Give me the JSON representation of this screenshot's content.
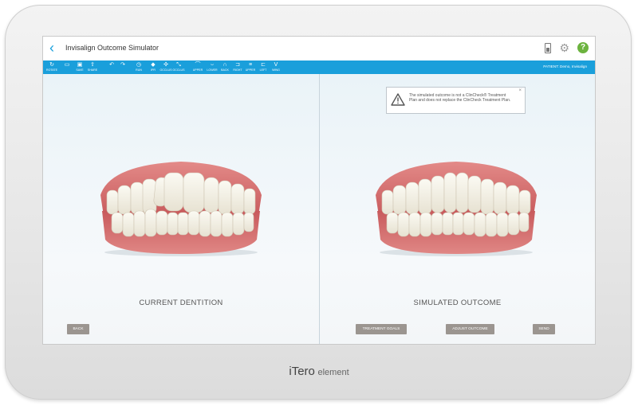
{
  "app": {
    "title": "Invisalign Outcome Simulator",
    "patient": "PATIENT: Demo, Invisalign"
  },
  "toolbar": {
    "tools": [
      {
        "icon": "↻",
        "label": "ROTATE"
      },
      {
        "icon": "▭",
        "label": ""
      },
      {
        "icon": "▣",
        "label": "SAVE"
      },
      {
        "icon": "⇪",
        "label": "SHARE"
      },
      {
        "icon": "↶",
        "label": ""
      },
      {
        "icon": "↷",
        "label": ""
      },
      {
        "icon": "◷",
        "label": "RUN"
      },
      {
        "icon": "◆",
        "label": "IPR"
      },
      {
        "icon": "✣",
        "label": "OCCLUS"
      },
      {
        "icon": "⤡",
        "label": "OCCLUS"
      },
      {
        "icon": "⌒",
        "label": "UPPER"
      },
      {
        "icon": "⌣",
        "label": "LOWER"
      },
      {
        "icon": "∩",
        "label": "BACK"
      },
      {
        "icon": "⊐",
        "label": "RIGHT"
      },
      {
        "icon": "≡",
        "label": "UPPER"
      },
      {
        "icon": "⊏",
        "label": "LEFT"
      },
      {
        "icon": "V",
        "label": "WING"
      }
    ]
  },
  "left_panel": {
    "label": "CURRENT DENTITION",
    "back_button": "BACK"
  },
  "right_panel": {
    "label": "SIMULATED OUTCOME",
    "notice": "The simulated outcome is not a ClinCheck® Treatment Plan and does not replace the ClinCheck Treatment Plan.",
    "notice_close": "×",
    "buttons": {
      "treatment_goals": "TREATMENT GOALS",
      "adjust_outcome": "ADJUST OUTCOME",
      "send": "SEND"
    }
  },
  "device": {
    "brand_main": "iTero",
    "brand_sub": "element"
  }
}
